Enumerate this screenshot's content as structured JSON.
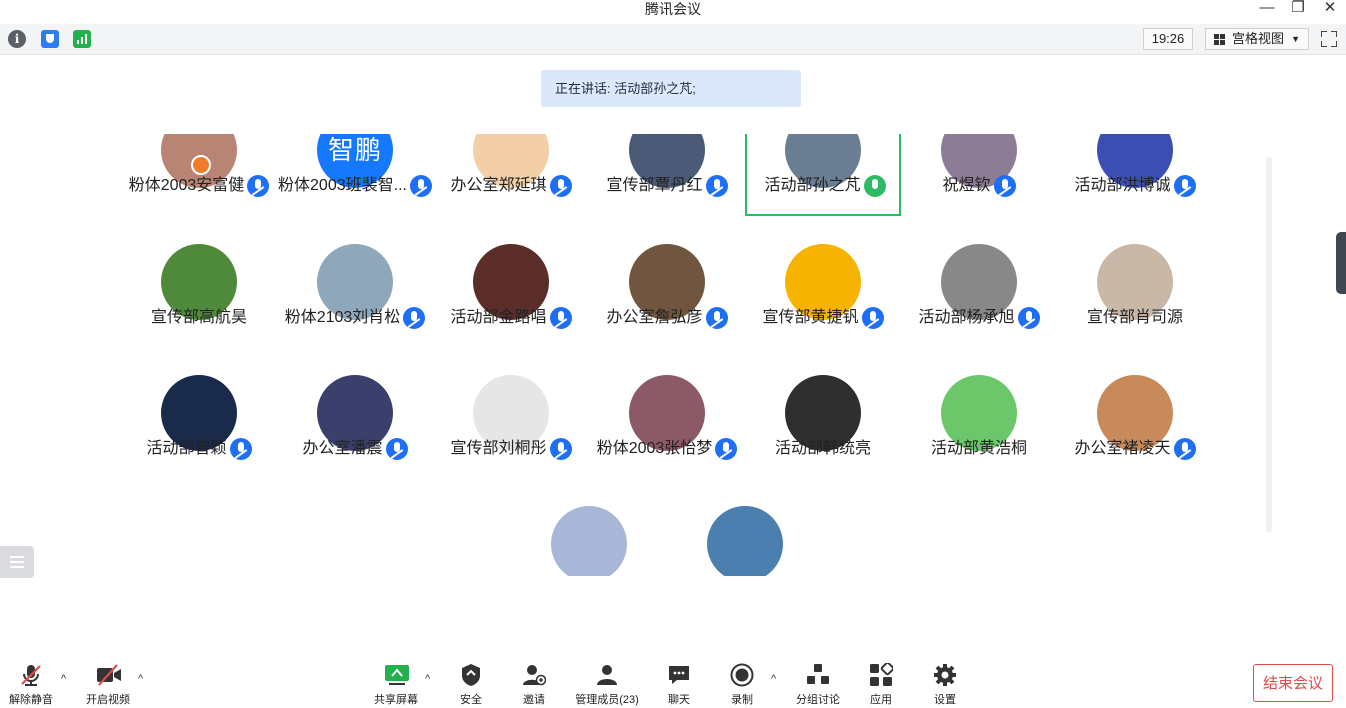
{
  "window": {
    "title": "腾讯会议",
    "minimize": "—",
    "restore": "❐",
    "close": "✕"
  },
  "topbar": {
    "time": "19:26",
    "view_label": "宫格视图",
    "view_caret": "▼"
  },
  "speaking": {
    "text": "正在讲话: 活动部孙之芃;"
  },
  "participants": [
    {
      "name": "粉体2003安富健",
      "mic": true,
      "avatar_color": "#b88474"
    },
    {
      "name": "粉体2003班裴智...",
      "mic": true,
      "avatar_color": "#1677ff",
      "avatar_text": "智鹏"
    },
    {
      "name": "办公室郑延琪",
      "mic": true,
      "avatar_color": "#f2cfa7"
    },
    {
      "name": "宣传部覃丹红",
      "mic": true,
      "avatar_color": "#4a5a77"
    },
    {
      "name": "活动部孙之芃",
      "mic": true,
      "speaking": true,
      "avatar_color": "#6a7d92"
    },
    {
      "name": "祝煜钦",
      "mic": true,
      "avatar_color": "#8d7c96"
    },
    {
      "name": "活动部洪博诚",
      "mic": true,
      "avatar_color": "#3b4fb3"
    },
    {
      "name": "宣传部高航昊",
      "mic": false,
      "avatar_color": "#4f8a3c"
    },
    {
      "name": "粉体2103刘肖松",
      "mic": true,
      "avatar_color": "#8fa7bb"
    },
    {
      "name": "活动部金路唱",
      "mic": true,
      "avatar_color": "#5b2e2a"
    },
    {
      "name": "办公室詹弘彦",
      "mic": true,
      "avatar_color": "#70563f"
    },
    {
      "name": "宣传部黄捷钒",
      "mic": true,
      "avatar_color": "#f6b400"
    },
    {
      "name": "活动部杨承旭",
      "mic": true,
      "avatar_color": "#888888"
    },
    {
      "name": "宣传部肖司源",
      "mic": false,
      "avatar_color": "#c9b8a8"
    },
    {
      "name": "活动部曾颖",
      "mic": true,
      "avatar_color": "#1a2a4a"
    },
    {
      "name": "办公室潘震",
      "mic": true,
      "avatar_color": "#3b3f6b"
    },
    {
      "name": "宣传部刘桐彤",
      "mic": true,
      "avatar_color": "#e6e6e6"
    },
    {
      "name": "粉体2003张怡梦",
      "mic": true,
      "avatar_color": "#8b5a66"
    },
    {
      "name": "活动部韩统亮",
      "mic": false,
      "avatar_color": "#2f2f2f"
    },
    {
      "name": "活动部黄浩桐",
      "mic": false,
      "avatar_color": "#6cc76a"
    },
    {
      "name": "办公室褚凌天",
      "mic": true,
      "avatar_color": "#c88a5a"
    },
    {
      "name": "",
      "mic": false,
      "avatar_color": "#a8b7d8"
    },
    {
      "name": "",
      "mic": false,
      "avatar_color": "#4a7fb0"
    }
  ],
  "bottombar": {
    "unmute": "解除静音",
    "start_video": "开启视频",
    "share_screen": "共享屏幕",
    "security": "安全",
    "invite": "邀请",
    "manage_members": "管理成员(23)",
    "chat": "聊天",
    "record": "录制",
    "breakout": "分组讨论",
    "apps": "应用",
    "settings": "设置",
    "end_meeting": "结束会议",
    "caret": "^"
  },
  "colors": {
    "accent": "#1677ff",
    "speaking_border": "#2dba66",
    "end_red": "#e24b4b",
    "banner_bg": "#dbe8fb"
  }
}
